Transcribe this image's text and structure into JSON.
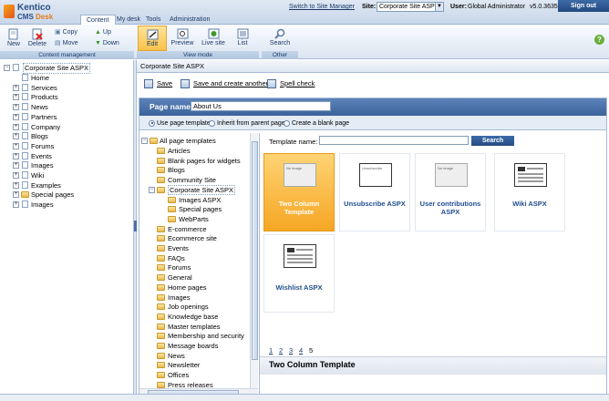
{
  "header": {
    "brand": "Kentico",
    "product_prefix": "CMS",
    "product_suffix": "Desk",
    "tabs": [
      "Content",
      "My desk",
      "Tools",
      "Administration"
    ],
    "switch_link": "Switch to Site Manager",
    "site_label": "Site:",
    "site_value": "Corporate Site ASPX",
    "user_label": "User:",
    "user_name": "Global Administrator",
    "version": "v5.0.3635",
    "signout": "Sign out"
  },
  "toolbar": {
    "content_management": {
      "label": "Content management",
      "new": "New",
      "delete": "Delete",
      "copy": "Copy",
      "move": "Move",
      "up": "Up",
      "down": "Down"
    },
    "view_mode": {
      "label": "View mode",
      "edit": "Edit",
      "preview": "Preview",
      "live_site": "Live site",
      "list": "List"
    },
    "other": {
      "label": "Other",
      "search": "Search"
    },
    "help": "?"
  },
  "content_tree": {
    "root": "Corporate Site ASPX",
    "items": [
      "Home",
      "Services",
      "Products",
      "News",
      "Partners",
      "Company",
      "Blogs",
      "Forums",
      "Events",
      "Images",
      "Wiki",
      "Examples",
      "Special pages",
      "Images"
    ]
  },
  "right": {
    "breadcrumb": "Corporate Site ASPX",
    "actions": {
      "save": "Save",
      "save_create": "Save and create another",
      "spell": "Spell check"
    },
    "page_name_label": "Page name:",
    "page_name_value": "About Us",
    "radios": [
      "Use page template",
      "Inherit from parent page",
      "Create a blank page"
    ],
    "selected_radio": 0,
    "categories": {
      "root": "All page templates",
      "items": [
        "Articles",
        "Blank pages for widgets",
        "Blogs",
        "Community Site",
        "Corporate Site ASPX",
        "Images ASPX",
        "Special pages",
        "WebParts",
        "E-commerce",
        "Ecommerce site",
        "Events",
        "FAQs",
        "Forums",
        "General",
        "Home pages",
        "Images",
        "Job openings",
        "Knowledge base",
        "Master templates",
        "Membership and security",
        "Message boards",
        "News",
        "Newsletter",
        "Offices",
        "Press releases"
      ]
    },
    "template_name_label": "Template name:",
    "search_button": "Search",
    "tiles": [
      {
        "title": "Two Column Template",
        "thumb_text": "No image"
      },
      {
        "title": "Unsubscribe ASPX",
        "thumb_text": "Unsubscribe"
      },
      {
        "title": "User contributions ASPX",
        "thumb_text": "No image"
      },
      {
        "title": "Wiki ASPX",
        "thumb_text": ""
      },
      {
        "title": "Wishlist ASPX",
        "thumb_text": ""
      }
    ],
    "pager": [
      "1",
      "2",
      "3",
      "4",
      "5"
    ],
    "current_page": "5",
    "selected_template": "Two Column Template"
  }
}
